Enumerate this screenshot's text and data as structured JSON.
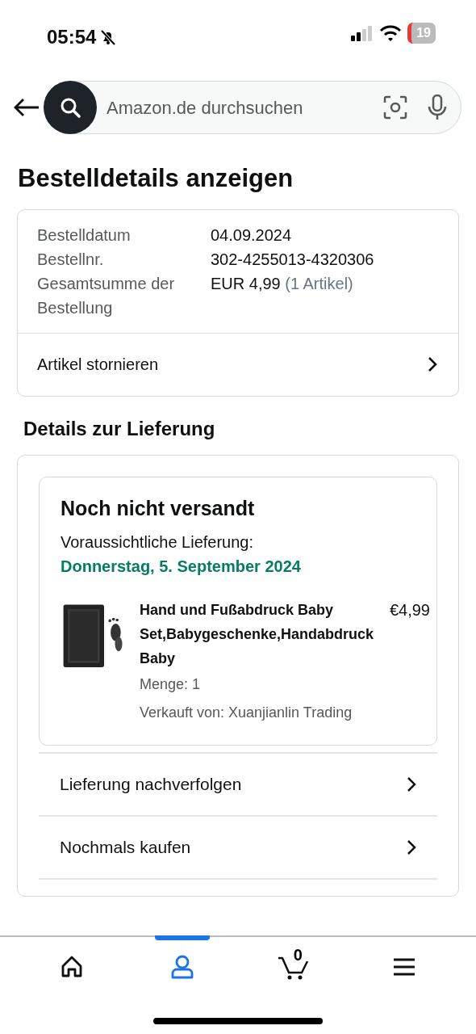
{
  "status_bar": {
    "time": "05:54",
    "battery": "19",
    "muted": true
  },
  "search": {
    "placeholder": "Amazon.de durchsuchen"
  },
  "title": "Bestelldetails anzeigen",
  "order": {
    "fields": [
      {
        "label": "Bestelldatum",
        "value": "04.09.2024"
      },
      {
        "label": "Bestellnr.",
        "value": "302-4255013-4320306"
      },
      {
        "label": "Gesamtsumme der Bestellung",
        "value": "EUR 4,99",
        "note": "(1 Artikel)"
      }
    ],
    "cancel_link": "Artikel stornieren"
  },
  "delivery": {
    "heading": "Details zur Lieferung",
    "status": "Noch nicht versandt",
    "estimate_label": "Voraussichtliche Lieferung:",
    "estimate_date": "Donnerstag, 5. September 2024",
    "item": {
      "title": "Hand und Fußabdruck Baby Set,Babygeschenke,Handabdruck Baby",
      "price": "€4,99",
      "quantity": "Menge: 1",
      "seller": "Verkauft von: Xuanjianlin Trading"
    },
    "actions": [
      "Lieferung nachverfolgen",
      "Nochmals kaufen"
    ]
  },
  "tab_bar": {
    "cart_count": "0",
    "tabs": [
      {
        "kind": "home",
        "selected": false
      },
      {
        "kind": "account",
        "selected": true
      },
      {
        "kind": "cart",
        "selected": false
      },
      {
        "kind": "menu",
        "selected": false
      }
    ]
  }
}
